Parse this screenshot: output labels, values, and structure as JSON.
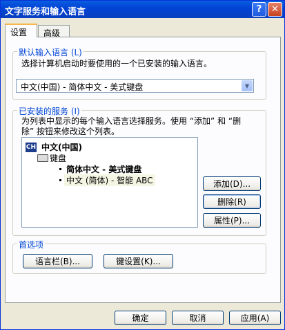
{
  "window": {
    "title": "文字服务和输入语言",
    "help_glyph": "?",
    "close_glyph": "✕"
  },
  "tabs": [
    {
      "label": "设置",
      "active": true
    },
    {
      "label": "高级",
      "active": false
    }
  ],
  "default_language": {
    "legend": "默认输入语言 (L)",
    "description": "选择计算机启动时要使用的一个已安装的输入语言。",
    "selected": "中文(中国) - 简体中文 - 美式键盘"
  },
  "installed_services": {
    "legend": "已安装的服务 (I)",
    "description_line1": "为列表中显示的每个输入语言选择服务。使用 “添加” 和 “删",
    "description_line2": "除” 按钮来修改这个列表。",
    "language_badge": "CH",
    "language": "中文(中国)",
    "category": "键盘",
    "items": [
      "简体中文 - 美式键盘",
      "中文 (简体) - 智能 ABC"
    ],
    "add_button": "添加(D)...",
    "remove_button": "删除(R)",
    "properties_button": "属性(P)..."
  },
  "preferences": {
    "legend": "首选项",
    "language_bar_button": "语言栏(B)...",
    "key_settings_button": "键设置(K)..."
  },
  "footer": {
    "ok_button": "确定",
    "cancel_button": "取消",
    "apply_button": "应用(A)"
  },
  "colors": {
    "titlebar": "#0A5FE0",
    "group_legend": "#0046D5",
    "dialog_bg": "#ECE9D8"
  }
}
